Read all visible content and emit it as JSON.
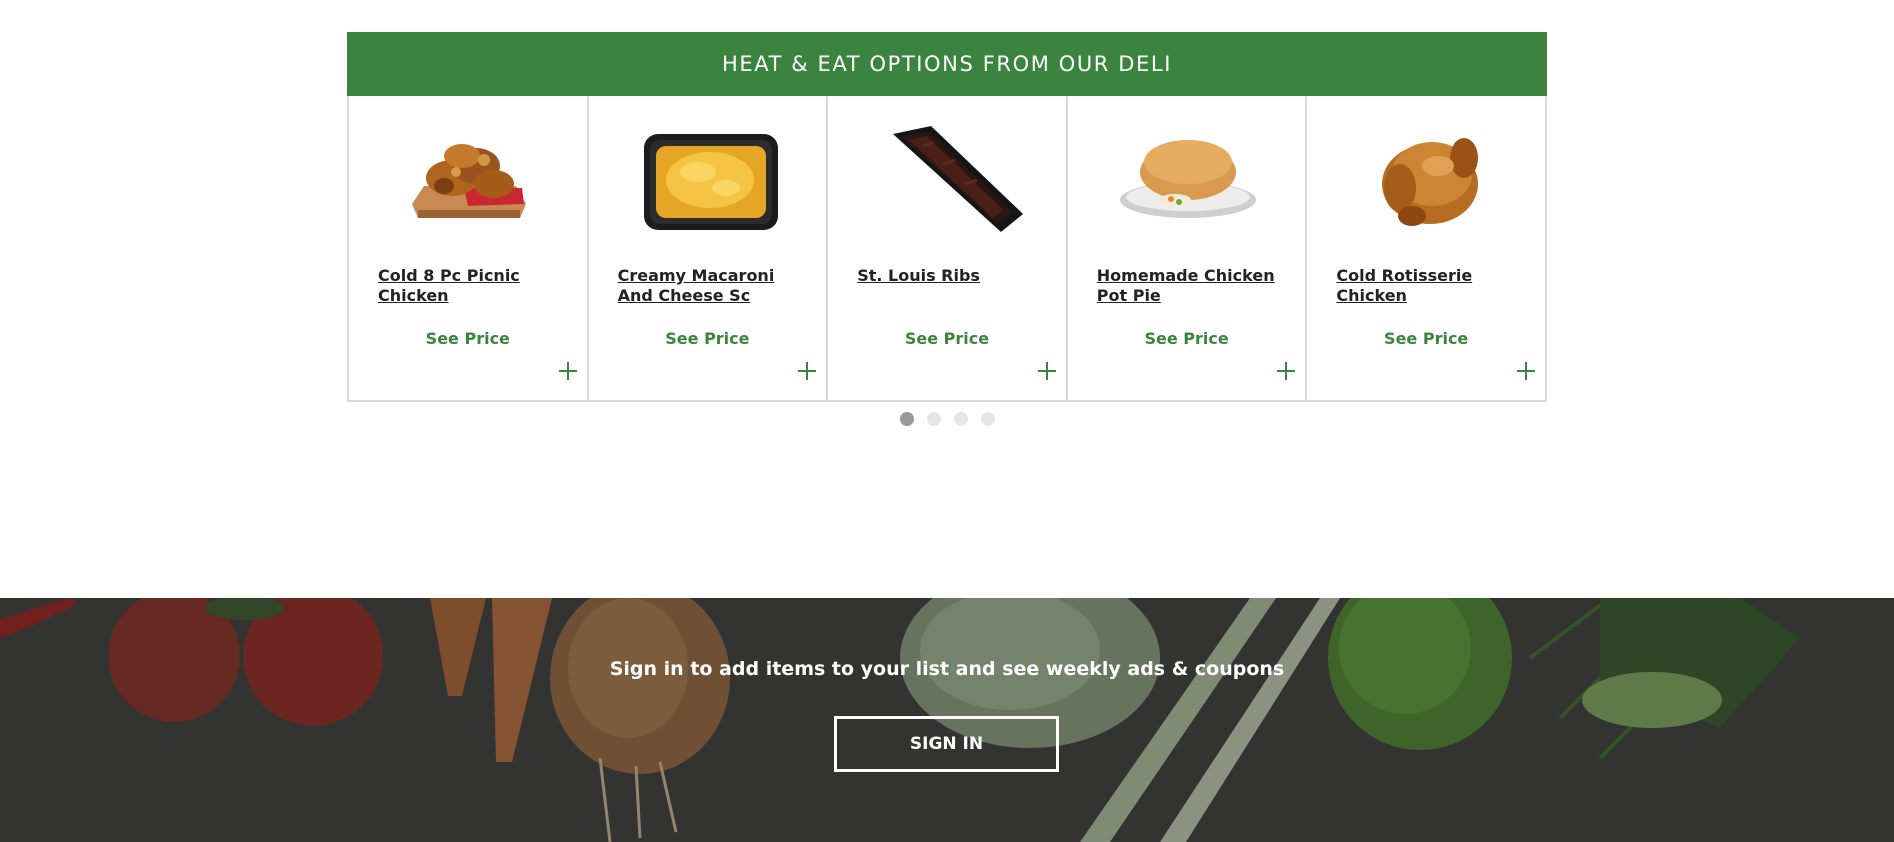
{
  "deli": {
    "heading": "HEAT & EAT OPTIONS FROM OUR DELI",
    "see_price_label": "See Price",
    "products": [
      {
        "name": "Cold 8 Pc Picnic Chicken",
        "image": "fried-chicken-image"
      },
      {
        "name": "Creamy Macaroni And Cheese Sc",
        "image": "mac-and-cheese-image"
      },
      {
        "name": "St. Louis Ribs",
        "image": "ribs-image"
      },
      {
        "name": "Homemade Chicken Pot Pie",
        "image": "pot-pie-image"
      },
      {
        "name": "Cold Rotisserie Chicken",
        "image": "rotisserie-chicken-image"
      }
    ],
    "pagination": {
      "pages": 4,
      "active": 1
    }
  },
  "signin": {
    "message": "Sign in to add items to your list and see weekly ads & coupons",
    "button_label": "SIGN IN"
  },
  "colors": {
    "brand_green": "#3b843f",
    "text_dark": "#222222",
    "banner_bg": "#3e3e3c"
  }
}
